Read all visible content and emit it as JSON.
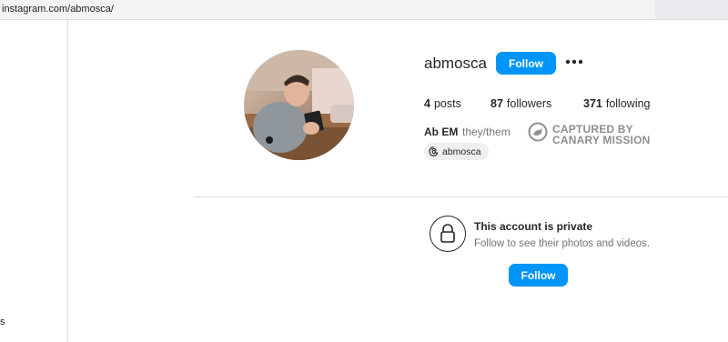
{
  "browser": {
    "url": "instagram.com/abmosca/"
  },
  "sidebar": {
    "partial_item_label": "s"
  },
  "profile": {
    "username": "abmosca",
    "follow_label": "Follow",
    "more_icon": "more-options-icon",
    "stats": {
      "posts_count": "4",
      "posts_label": "posts",
      "followers_count": "87",
      "followers_label": "followers",
      "following_count": "371",
      "following_label": "following"
    },
    "full_name": "Ab EM",
    "pronouns": "they/them",
    "threads_handle": "abmosca",
    "threads_icon": "threads-icon",
    "overlay": {
      "line1": "CAPTURED BY",
      "line2": "CANARY MISSION"
    }
  },
  "private_notice": {
    "title": "This account is private",
    "subtitle": "Follow to see their photos and videos.",
    "follow_label": "Follow",
    "icon": "lock-icon"
  },
  "colors": {
    "accent": "#0095f6",
    "divider": "#dbdbdb",
    "muted_text": "#737373",
    "overlay_text": "#8e8e8e"
  }
}
